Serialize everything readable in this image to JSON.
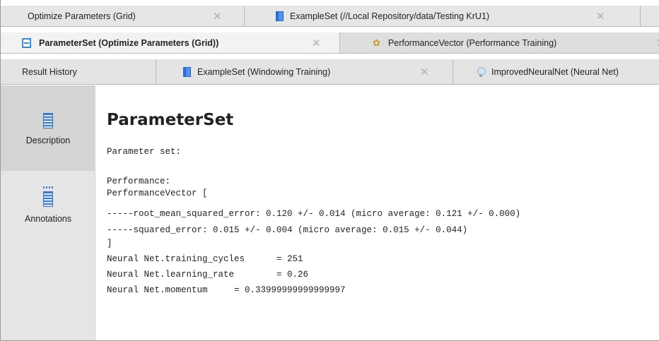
{
  "tabs_row1": [
    {
      "label": "Optimize Parameters (Grid)",
      "close": "✕"
    },
    {
      "label": "ExampleSet (//Local Repository/data/Testing KrU1)",
      "close": "✕",
      "icon": "exampleset-icon"
    }
  ],
  "tabs_row2": [
    {
      "label": "ParameterSet (Optimize Parameters (Grid))",
      "close": "✕",
      "icon": "parameterset-icon",
      "active": true
    },
    {
      "label": "PerformanceVector (Performance Training)",
      "close": "✕",
      "icon": "performance-icon"
    }
  ],
  "tabs_row3": [
    {
      "label": "Result History"
    },
    {
      "label": "ExampleSet (Windowing Training)",
      "close": "✕",
      "icon": "exampleset-icon"
    },
    {
      "label": "ImprovedNeuralNet (Neural Net)",
      "icon": "lightbulb-icon"
    }
  ],
  "sidebar": {
    "description": "Description",
    "annotations": "Annotations"
  },
  "content": {
    "title": "ParameterSet",
    "lines": [
      "Parameter set:",
      "",
      "Performance:",
      "PerformanceVector [",
      "-----root_mean_squared_error: 0.120 +/- 0.014 (micro average: 0.121 +/- 0.000)",
      "-----squared_error: 0.015 +/- 0.004 (micro average: 0.015 +/- 0.044)",
      "]",
      "Neural Net.training_cycles      = 251",
      "Neural Net.learning_rate        = 0.26",
      "Neural Net.momentum     = 0.33999999999999997"
    ]
  },
  "colors": {
    "tab_bg": "#e3e3e3",
    "active_tab_bg": "#f2f2f2",
    "sidebar_bg": "#e5e5e5",
    "sidebar_selected_bg": "#d4d4d4",
    "icon_blue": "#3f7fd6"
  }
}
